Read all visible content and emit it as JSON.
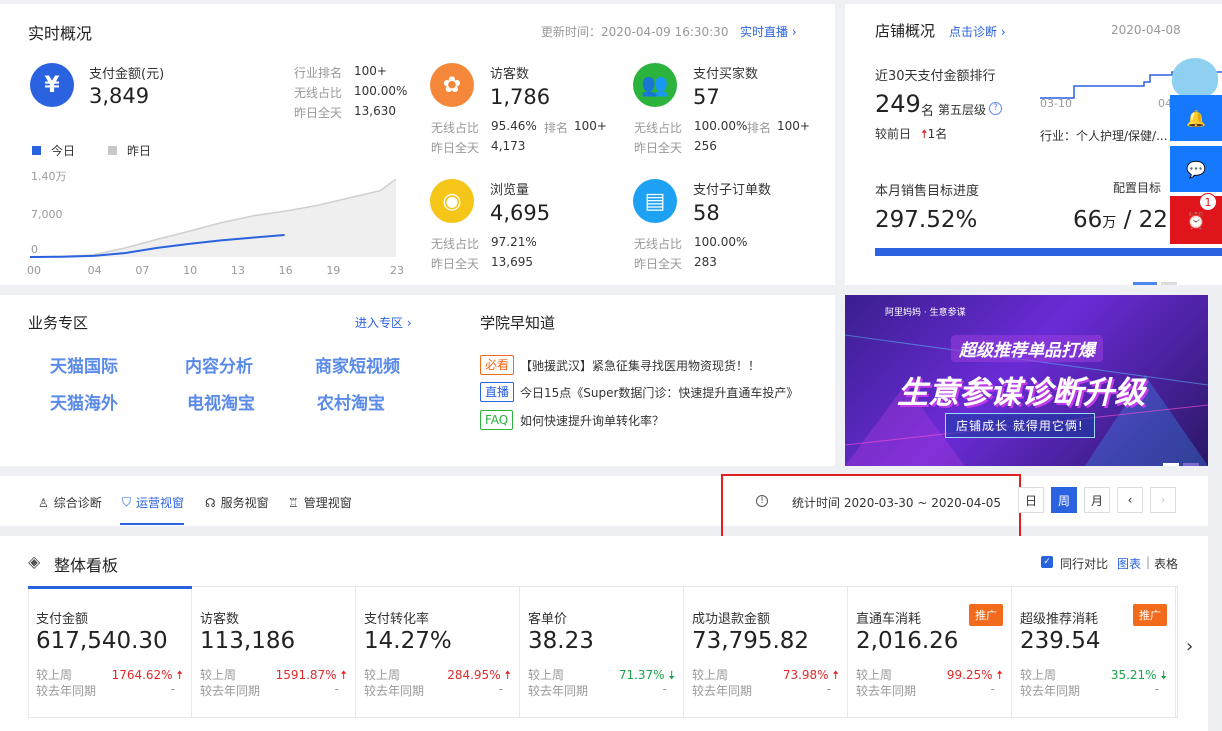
{
  "realtime": {
    "title": "实时概况",
    "update_time": "更新时间：2020-04-09 16:30:30",
    "live_link": "实时直播",
    "pay": {
      "label": "支付金额(元)",
      "value": "3,849",
      "rank_label": "行业排名",
      "rank_value": "100+",
      "wireless_label": "无线占比",
      "wireless_value": "100.00%",
      "yesterday_label": "昨日全天",
      "yesterday_value": "13,630"
    },
    "legend_today": "今日",
    "legend_yesterday": "昨日",
    "cells": [
      {
        "label": "访客数",
        "value": "1,786",
        "wireless_label": "无线占比",
        "wireless_value": "95.46%",
        "rank_label": "排名",
        "rank_value": "100+",
        "yesterday_label": "昨日全天",
        "yesterday_value": "4,173",
        "color": "#f5873a"
      },
      {
        "label": "支付买家数",
        "value": "57",
        "wireless_label": "无线占比",
        "wireless_value": "100.00%",
        "rank_label": "排名",
        "rank_value": "100+",
        "yesterday_label": "昨日全天",
        "yesterday_value": "256",
        "color": "#2bb33e"
      },
      {
        "label": "浏览量",
        "value": "4,695",
        "wireless_label": "无线占比",
        "wireless_value": "97.21%",
        "yesterday_label": "昨日全天",
        "yesterday_value": "13,695",
        "color": "#f5c518"
      },
      {
        "label": "支付子订单数",
        "value": "58",
        "wireless_label": "无线占比",
        "wireless_value": "100.00%",
        "yesterday_label": "昨日全天",
        "yesterday_value": "283",
        "color": "#1da1f2"
      }
    ]
  },
  "chart_data": {
    "type": "area",
    "x": [
      "00",
      "04",
      "07",
      "10",
      "13",
      "16",
      "19",
      "23"
    ],
    "y_ticks": [
      "1.40万",
      "7,000",
      "0"
    ],
    "ylim": [
      0,
      14000
    ],
    "series": [
      {
        "name": "今日",
        "x": [
          0,
          2,
          4,
          6,
          8,
          10,
          12,
          14,
          16
        ],
        "values": [
          0,
          50,
          200,
          700,
          1600,
          2300,
          2900,
          3400,
          3849
        ],
        "color": "#2a62e0"
      },
      {
        "name": "昨日",
        "x": [
          0,
          2,
          4,
          6,
          8,
          10,
          12,
          14,
          16,
          18,
          20,
          22,
          23
        ],
        "values": [
          0,
          100,
          400,
          1600,
          3100,
          4500,
          6000,
          7200,
          8000,
          9000,
          10300,
          11600,
          13630
        ],
        "color": "#cfcfcf"
      }
    ]
  },
  "store": {
    "title": "店铺概况",
    "diagnose": "点击诊断",
    "date": "2020-04-08",
    "rank_title": "近30天支付金额排行",
    "rank_value": "249",
    "rank_unit": "名",
    "rank_level": "第五层级",
    "compare_label": "较前日",
    "compare_value": "1名",
    "industry": "行业：个人护理/保健/...",
    "spark_x_start": "03-10",
    "spark_x_end": "04-0",
    "target_label": "本月销售目标进度",
    "target_value": "297.52%",
    "config_label": "配置目标",
    "amount": "66",
    "amount_unit": "万",
    "sep": "/",
    "amount2": "22",
    "target_progress": 1.0
  },
  "business": {
    "title": "业务专区",
    "enter": "进入专区",
    "items": [
      "天猫国际",
      "内容分析",
      "商家短视频",
      "天猫海外",
      "电视淘宝",
      "农村淘宝"
    ]
  },
  "academy": {
    "title": "学院早知道",
    "items": [
      {
        "tag": "必看",
        "text": "【驰援武汉】紧急征集寻找医用物资现货！！"
      },
      {
        "tag": "直播",
        "text": "今日15点《Super数据门诊：快速提升直通车投产》"
      },
      {
        "tag": "FAQ",
        "text": "如何快速提升询单转化率？"
      }
    ]
  },
  "banner": {
    "brand1": "阿里妈妈",
    "brand2": "生意参谋",
    "headline": "超级推荐单品打爆",
    "title": "生意参谋诊断升级",
    "subtitle": "店铺成长 就得用它俩!"
  },
  "tabs": [
    "综合诊断",
    "运营视窗",
    "服务视窗",
    "管理视窗"
  ],
  "stat_time": "统计时间 2020-03-30 ~ 2020-04-05",
  "period": [
    "日",
    "周",
    "月"
  ],
  "board": {
    "title": "整体看板",
    "compare_label": "同行对比",
    "view_chart": "图表",
    "view_sep": "|",
    "view_table": "表格",
    "last_week": "较上周",
    "last_year": "较去年同期",
    "dash": "-",
    "promo": "推广",
    "metrics": [
      {
        "label": "支付金额",
        "value": "617,540.30",
        "pct": "1764.62%",
        "dir": "up"
      },
      {
        "label": "访客数",
        "value": "113,186",
        "pct": "1591.87%",
        "dir": "up"
      },
      {
        "label": "支付转化率",
        "value": "14.27%",
        "pct": "284.95%",
        "dir": "up"
      },
      {
        "label": "客单价",
        "value": "38.23",
        "pct": "71.37%",
        "dir": "down"
      },
      {
        "label": "成功退款金额",
        "value": "73,795.82",
        "pct": "73.98%",
        "dir": "up"
      },
      {
        "label": "直通车消耗",
        "value": "2,016.26",
        "pct": "99.25%",
        "dir": "up"
      },
      {
        "label": "超级推荐消耗",
        "value": "239.54",
        "pct": "35.21%",
        "dir": "down"
      }
    ]
  },
  "sidebar": {
    "badge": "1"
  }
}
